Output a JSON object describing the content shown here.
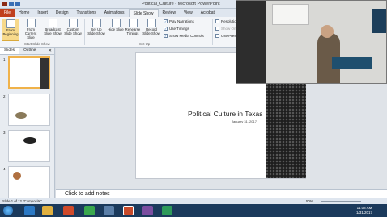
{
  "window": {
    "title": "Political_Culture - Microsoft PowerPoint"
  },
  "tabs": [
    "File",
    "Home",
    "Insert",
    "Design",
    "Transitions",
    "Animations",
    "Slide Show",
    "Review",
    "View",
    "Acrobat"
  ],
  "ribbon": {
    "from_beginning": "From Beginning",
    "from_current": "From Current Slide",
    "broadcast": "Broadcast Slide Show",
    "custom": "Custom Slide Show",
    "group_start": "Start Slide Show",
    "setup": "Set Up Slide Show",
    "hide": "Hide Slide",
    "rehearse": "Rehearse Timings",
    "record": "Record Slide Show",
    "group_setup": "Set Up",
    "play_narrations": "Play Narrations",
    "use_timings": "Use Timings",
    "show_media": "Show Media Controls",
    "resolution": "Resolutio",
    "show_on": "Show On:",
    "use_presenter": "Use Prese"
  },
  "panel": {
    "tab_slides": "Slides",
    "tab_outline": "Outline",
    "nums": [
      "1",
      "2",
      "3",
      "4"
    ]
  },
  "slide": {
    "title": "Political Culture in Texas",
    "date": "January 31, 2017"
  },
  "notes": {
    "placeholder": "Click to add notes"
  },
  "status": {
    "left": "Slide 1 of 12   \"Composite\"",
    "zoom": "50%"
  },
  "clock": {
    "time": "11:08 AM",
    "date": "1/31/2017"
  }
}
